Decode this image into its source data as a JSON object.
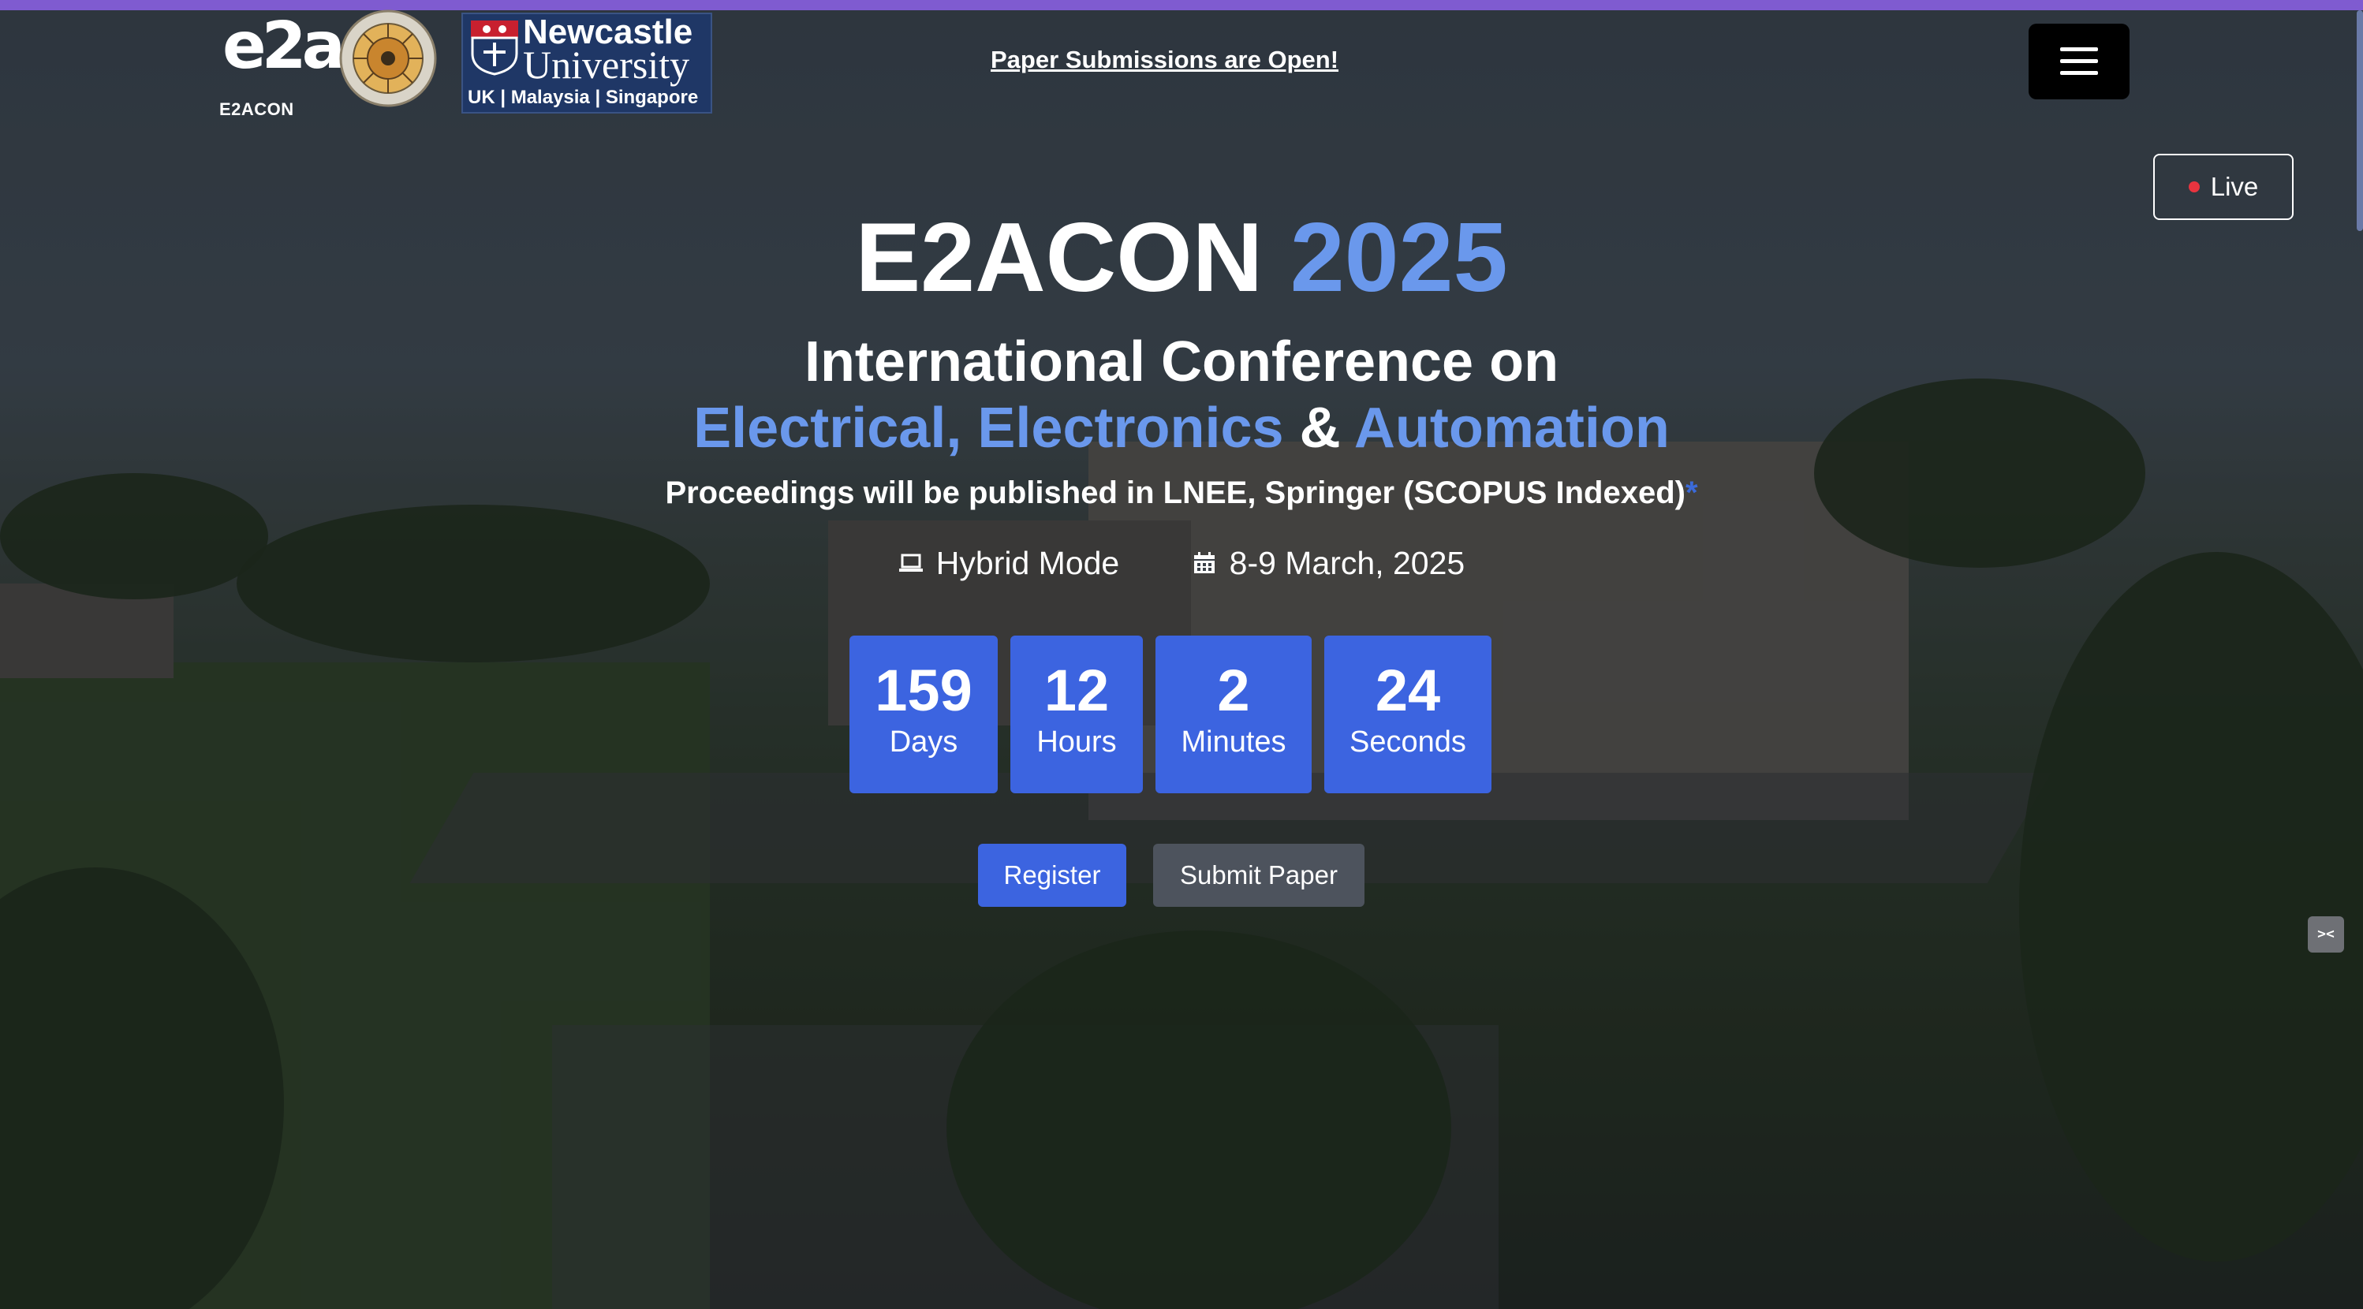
{
  "header": {
    "e2acon_logo": {
      "glyph": "e2a",
      "text": "E2ACON"
    },
    "newcastle_logo": {
      "line1": "Newcastle",
      "line2": "University",
      "line3": "UK | Malaysia | Singapore"
    },
    "announcement": "Paper Submissions are Open!",
    "menu_icon": "hamburger-menu-icon"
  },
  "live_button": {
    "label": "Live",
    "dot_color": "#e8343f"
  },
  "hero": {
    "title_main": "E2ACON",
    "title_year": "2025",
    "subtitle_line1": "International Conference on",
    "subtitle_electrical": "Electrical,",
    "subtitle_electronics": "Electronics",
    "subtitle_amp": "&",
    "subtitle_automation": "Automation",
    "proceedings": "Proceedings will be published in LNEE, Springer (SCOPUS Indexed)",
    "proceedings_star": "*",
    "mode": "Hybrid Mode",
    "date": "8-9 March, 2025"
  },
  "countdown": [
    {
      "value": "159",
      "label": "Days"
    },
    {
      "value": "12",
      "label": "Hours"
    },
    {
      "value": "2",
      "label": "Minutes"
    },
    {
      "value": "24",
      "label": "Seconds"
    }
  ],
  "actions": {
    "register": "Register",
    "submit": "Submit Paper"
  },
  "side_widget": {
    "glyph": "><"
  },
  "colors": {
    "accent_blue": "#6a98ec",
    "button_blue": "#3c64e0",
    "top_bar": "#7f5bd0"
  }
}
